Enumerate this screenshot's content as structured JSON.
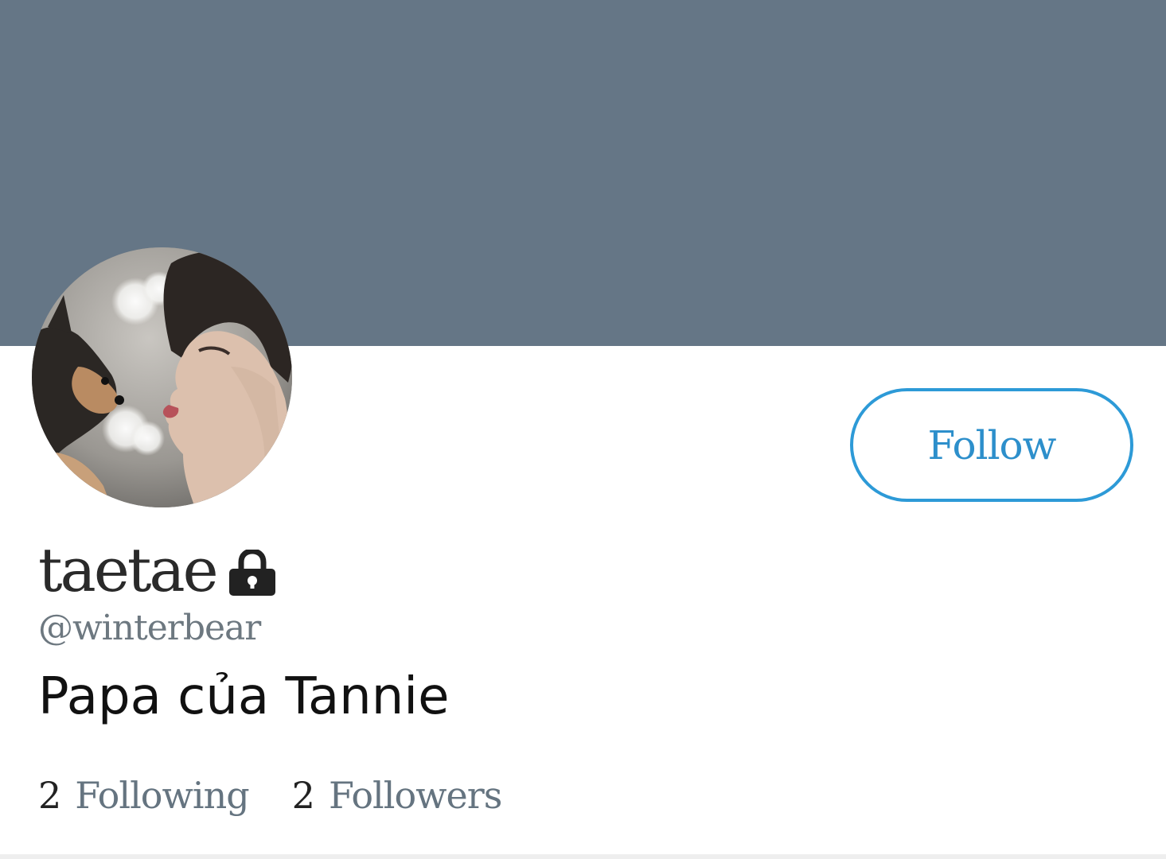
{
  "profile": {
    "display_name": "taetae",
    "handle": "@winterbear",
    "bio": "Papa của Tannie",
    "protected_icon": "lock-icon",
    "avatar_image": "profile-photo",
    "banner_color": "#657686"
  },
  "actions": {
    "follow_label": "Follow",
    "accent_color": "#2d9ad7"
  },
  "stats": {
    "following_count": "2",
    "following_label": "Following",
    "followers_count": "2",
    "followers_label": "Followers"
  }
}
